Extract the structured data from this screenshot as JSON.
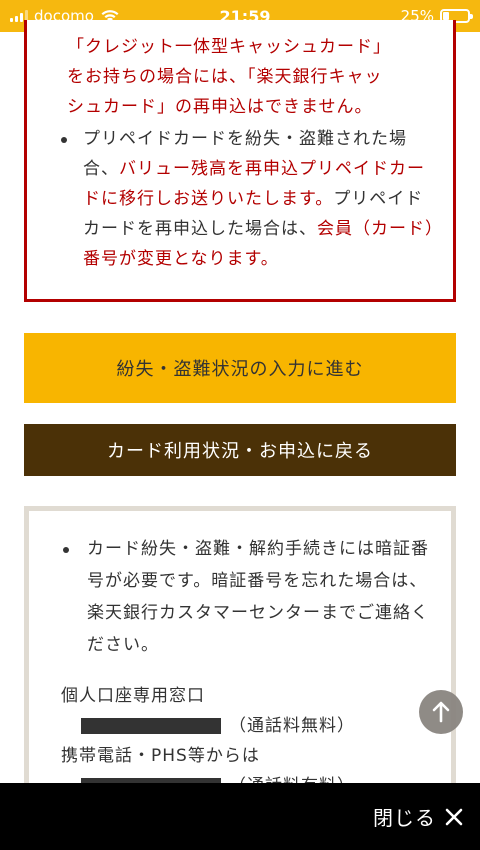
{
  "status_bar": {
    "carrier": "docomo",
    "time": "21:59",
    "battery_percent": "25%",
    "battery_level": 0.25,
    "color": "#f6b80f"
  },
  "warning_box": {
    "line_0": "「クレジット一体型キャッシュカード」",
    "line_1": "をお持ちの場合には、「楽天銀行キャッ",
    "line_2": "シュカード」の再申込はできません。",
    "bullet_prefix": "プリペイドカードを紛失・盗難された場合、",
    "bullet_red_1": "バリュー残高を再申込プリペイドカードに移行しお送りいたします。",
    "bullet_mid": "プリペイドカードを再申込した場合は、",
    "bullet_red_2": "会員（カード）番号が変更となります。",
    "border_color": "#b30000"
  },
  "buttons": {
    "proceed_label": "紛失・盗難状況の入力に進む",
    "back_label": "カード利用状況・お申込に戻る"
  },
  "info_box": {
    "bullet": "カード紛失・盗難・解約手続きには暗証番号が必要です。暗証番号を忘れた場合は、楽天銀行カスタマーセンターまでご連絡ください。",
    "personal_label": "個人口座専用窓口",
    "personal_fee": "（通話料無料）",
    "mobile_label": "携帯電話・PHS等からは",
    "mobile_fee": "（通話料有料）"
  },
  "bottom_bar": {
    "close_label": "閉じる"
  },
  "icons": {
    "signal": "signal-icon",
    "wifi": "wifi-icon",
    "battery": "battery-icon",
    "scroll_top": "arrow-up-icon",
    "close": "close-icon"
  }
}
